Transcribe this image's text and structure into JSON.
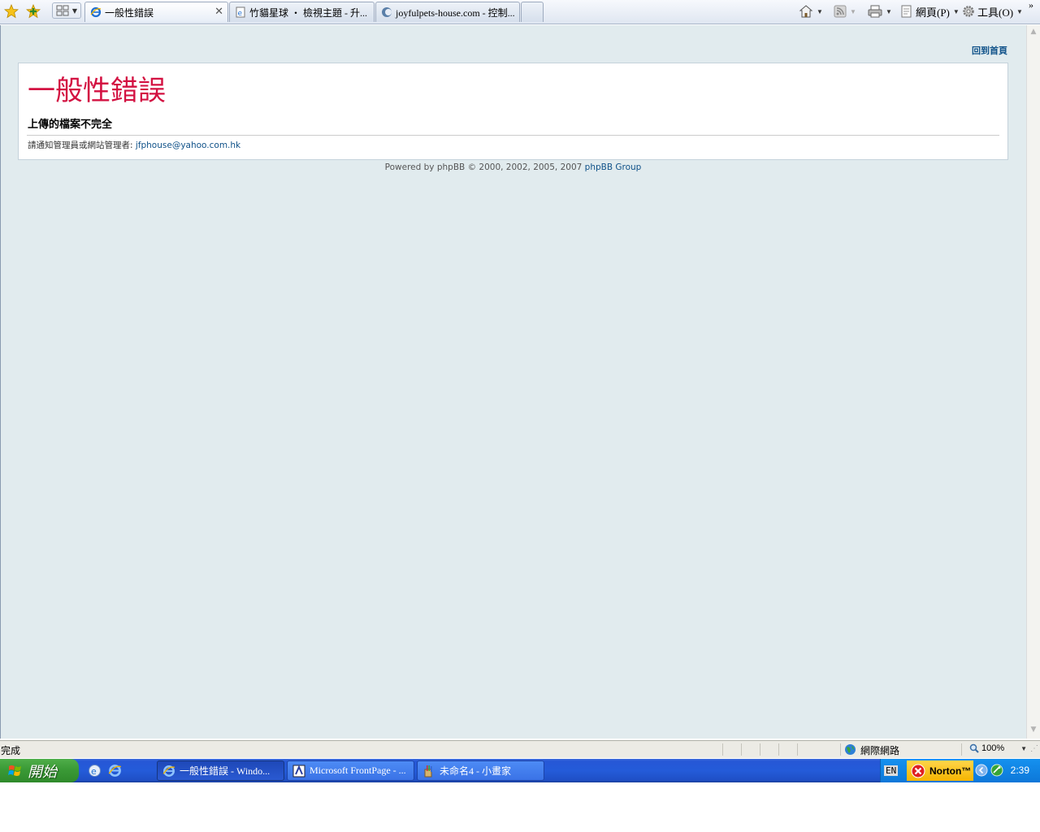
{
  "browser": {
    "tabs": [
      {
        "label": "一般性錯誤",
        "active": true
      },
      {
        "label": "竹貓星球 ‧ 檢視主題 - 升...",
        "active": false
      },
      {
        "label": "joyfulpets-house.com - 控制...",
        "active": false
      }
    ],
    "command_bar": {
      "page_label": "網頁(P)",
      "tools_label": "工具(O)"
    }
  },
  "page": {
    "home_link": "回到首頁",
    "error_title": "一般性錯誤",
    "error_message": "上傳的檔案不完全",
    "notify_text": "請通知管理員或網站管理者: ",
    "notify_email": "jfphouse@yahoo.com.hk",
    "footer_prefix": "Powered by phpBB © 2000, 2002, 2005, 2007 ",
    "footer_link": "phpBB Group",
    "colors": {
      "title": "#d31141",
      "link": "#105289",
      "page_bg": "#e1ebee"
    }
  },
  "statusbar": {
    "status": "完成",
    "zone": "網際網路",
    "zoom": "100%"
  },
  "taskbar": {
    "start_label": "開始",
    "tasks": [
      {
        "label": "一般性錯誤 - Windo...",
        "icon": "ie-icon",
        "active": true
      },
      {
        "label": "Microsoft FrontPage - ...",
        "icon": "frontpage-icon",
        "active": false
      },
      {
        "label": "未命名4 - 小畫家",
        "icon": "paint-icon",
        "active": false
      }
    ],
    "language": "EN",
    "norton": "Norton™",
    "clock": "2:39"
  }
}
